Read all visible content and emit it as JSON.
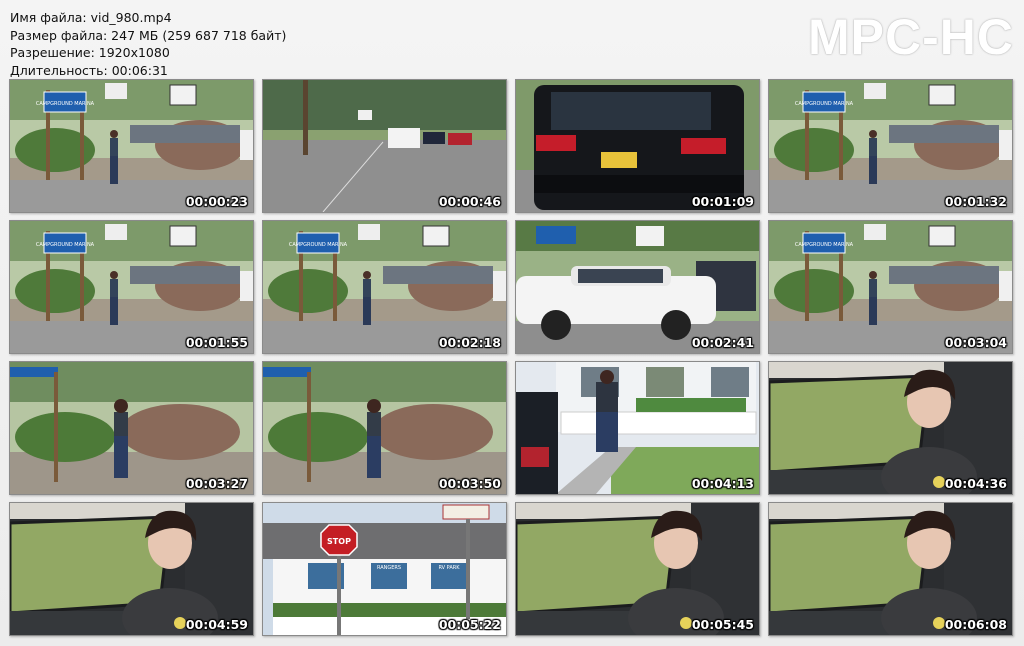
{
  "info": {
    "filename": "Имя файла: vid_980.mp4",
    "filesize": "Размер файла: 247 МБ (259 687 718 байт)",
    "resolution": "Разрешение: 1920x1080",
    "duration": "Длительность: 00:06:31"
  },
  "logo": "MPC-HC",
  "thumbnails": [
    {
      "time": "00:00:23",
      "scene": "roadside-sign"
    },
    {
      "time": "00:00:46",
      "scene": "road-cars"
    },
    {
      "time": "00:01:09",
      "scene": "black-suv"
    },
    {
      "time": "00:01:32",
      "scene": "roadside-sign"
    },
    {
      "time": "00:01:55",
      "scene": "roadside-sign"
    },
    {
      "time": "00:02:18",
      "scene": "roadside-sign"
    },
    {
      "time": "00:02:41",
      "scene": "white-suv"
    },
    {
      "time": "00:03:04",
      "scene": "roadside-sign"
    },
    {
      "time": "00:03:27",
      "scene": "roadside-woman"
    },
    {
      "time": "00:03:50",
      "scene": "roadside-woman"
    },
    {
      "time": "00:04:13",
      "scene": "sidewalk-house"
    },
    {
      "time": "00:04:36",
      "scene": "car-interior"
    },
    {
      "time": "00:04:59",
      "scene": "car-interior"
    },
    {
      "time": "00:05:22",
      "scene": "stop-sign-building"
    },
    {
      "time": "00:05:45",
      "scene": "car-interior"
    },
    {
      "time": "00:06:08",
      "scene": "car-interior"
    }
  ],
  "signs": {
    "campground": "CAMPGROUND MARINA",
    "stop": "STOP",
    "rangers": "RANGERS",
    "rv_park": "RV PARK"
  }
}
